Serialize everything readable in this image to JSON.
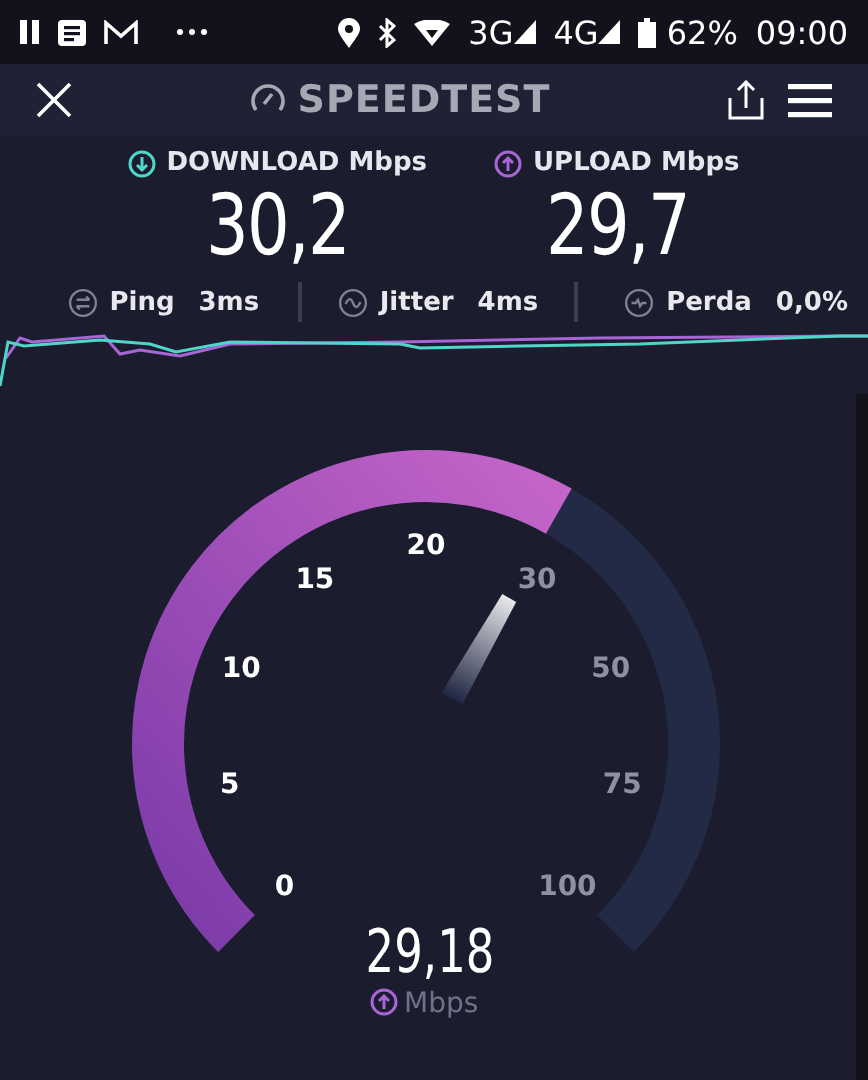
{
  "status_bar": {
    "network_3g": "3G",
    "network_4g": "4G",
    "battery": "62%",
    "time": "09:00"
  },
  "header": {
    "title": "SPEEDTEST"
  },
  "results": [
    {
      "kind": "download",
      "label": "DOWNLOAD Mbps",
      "value": "30,2"
    },
    {
      "kind": "upload",
      "label": "UPLOAD Mbps",
      "value": "29,7"
    }
  ],
  "stats": [
    {
      "kind": "ping",
      "label": "Ping",
      "value": "3ms"
    },
    {
      "kind": "jitter",
      "label": "Jitter",
      "value": "4ms"
    },
    {
      "kind": "loss",
      "label": "Perda",
      "value": "0,0%"
    }
  ],
  "gauge": {
    "ticks": [
      "0",
      "5",
      "10",
      "15",
      "20",
      "30",
      "50",
      "75",
      "100"
    ],
    "reading": "29,18",
    "unit": "Mbps"
  }
}
